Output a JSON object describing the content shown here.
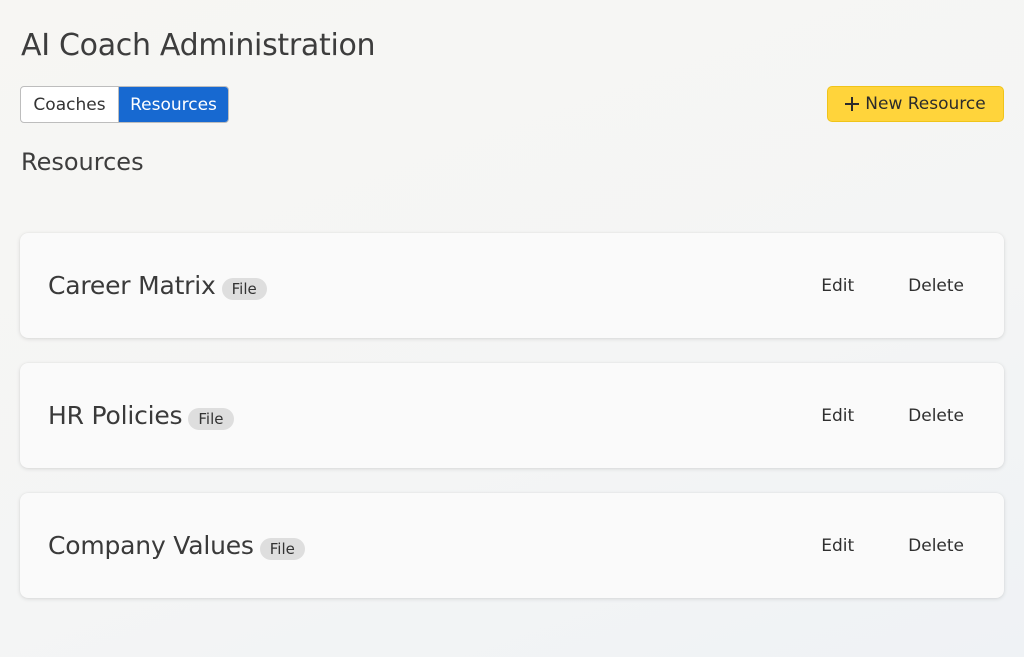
{
  "header": {
    "title": "AI Coach Administration"
  },
  "tabs": [
    {
      "label": "Coaches",
      "active": false
    },
    {
      "label": "Resources",
      "active": true
    }
  ],
  "toolbar": {
    "new_resource_label": "New Resource",
    "new_resource_icon": "plus-icon"
  },
  "section": {
    "title": "Resources"
  },
  "resources": [
    {
      "name": "Career Matrix",
      "type": "File",
      "edit_label": "Edit",
      "delete_label": "Delete"
    },
    {
      "name": "HR Policies",
      "type": "File",
      "edit_label": "Edit",
      "delete_label": "Delete"
    },
    {
      "name": "Company Values",
      "type": "File",
      "edit_label": "Edit",
      "delete_label": "Delete"
    }
  ],
  "colors": {
    "accent": "#1769d1",
    "primary_button": "#ffd43b",
    "badge": "#dedede"
  }
}
